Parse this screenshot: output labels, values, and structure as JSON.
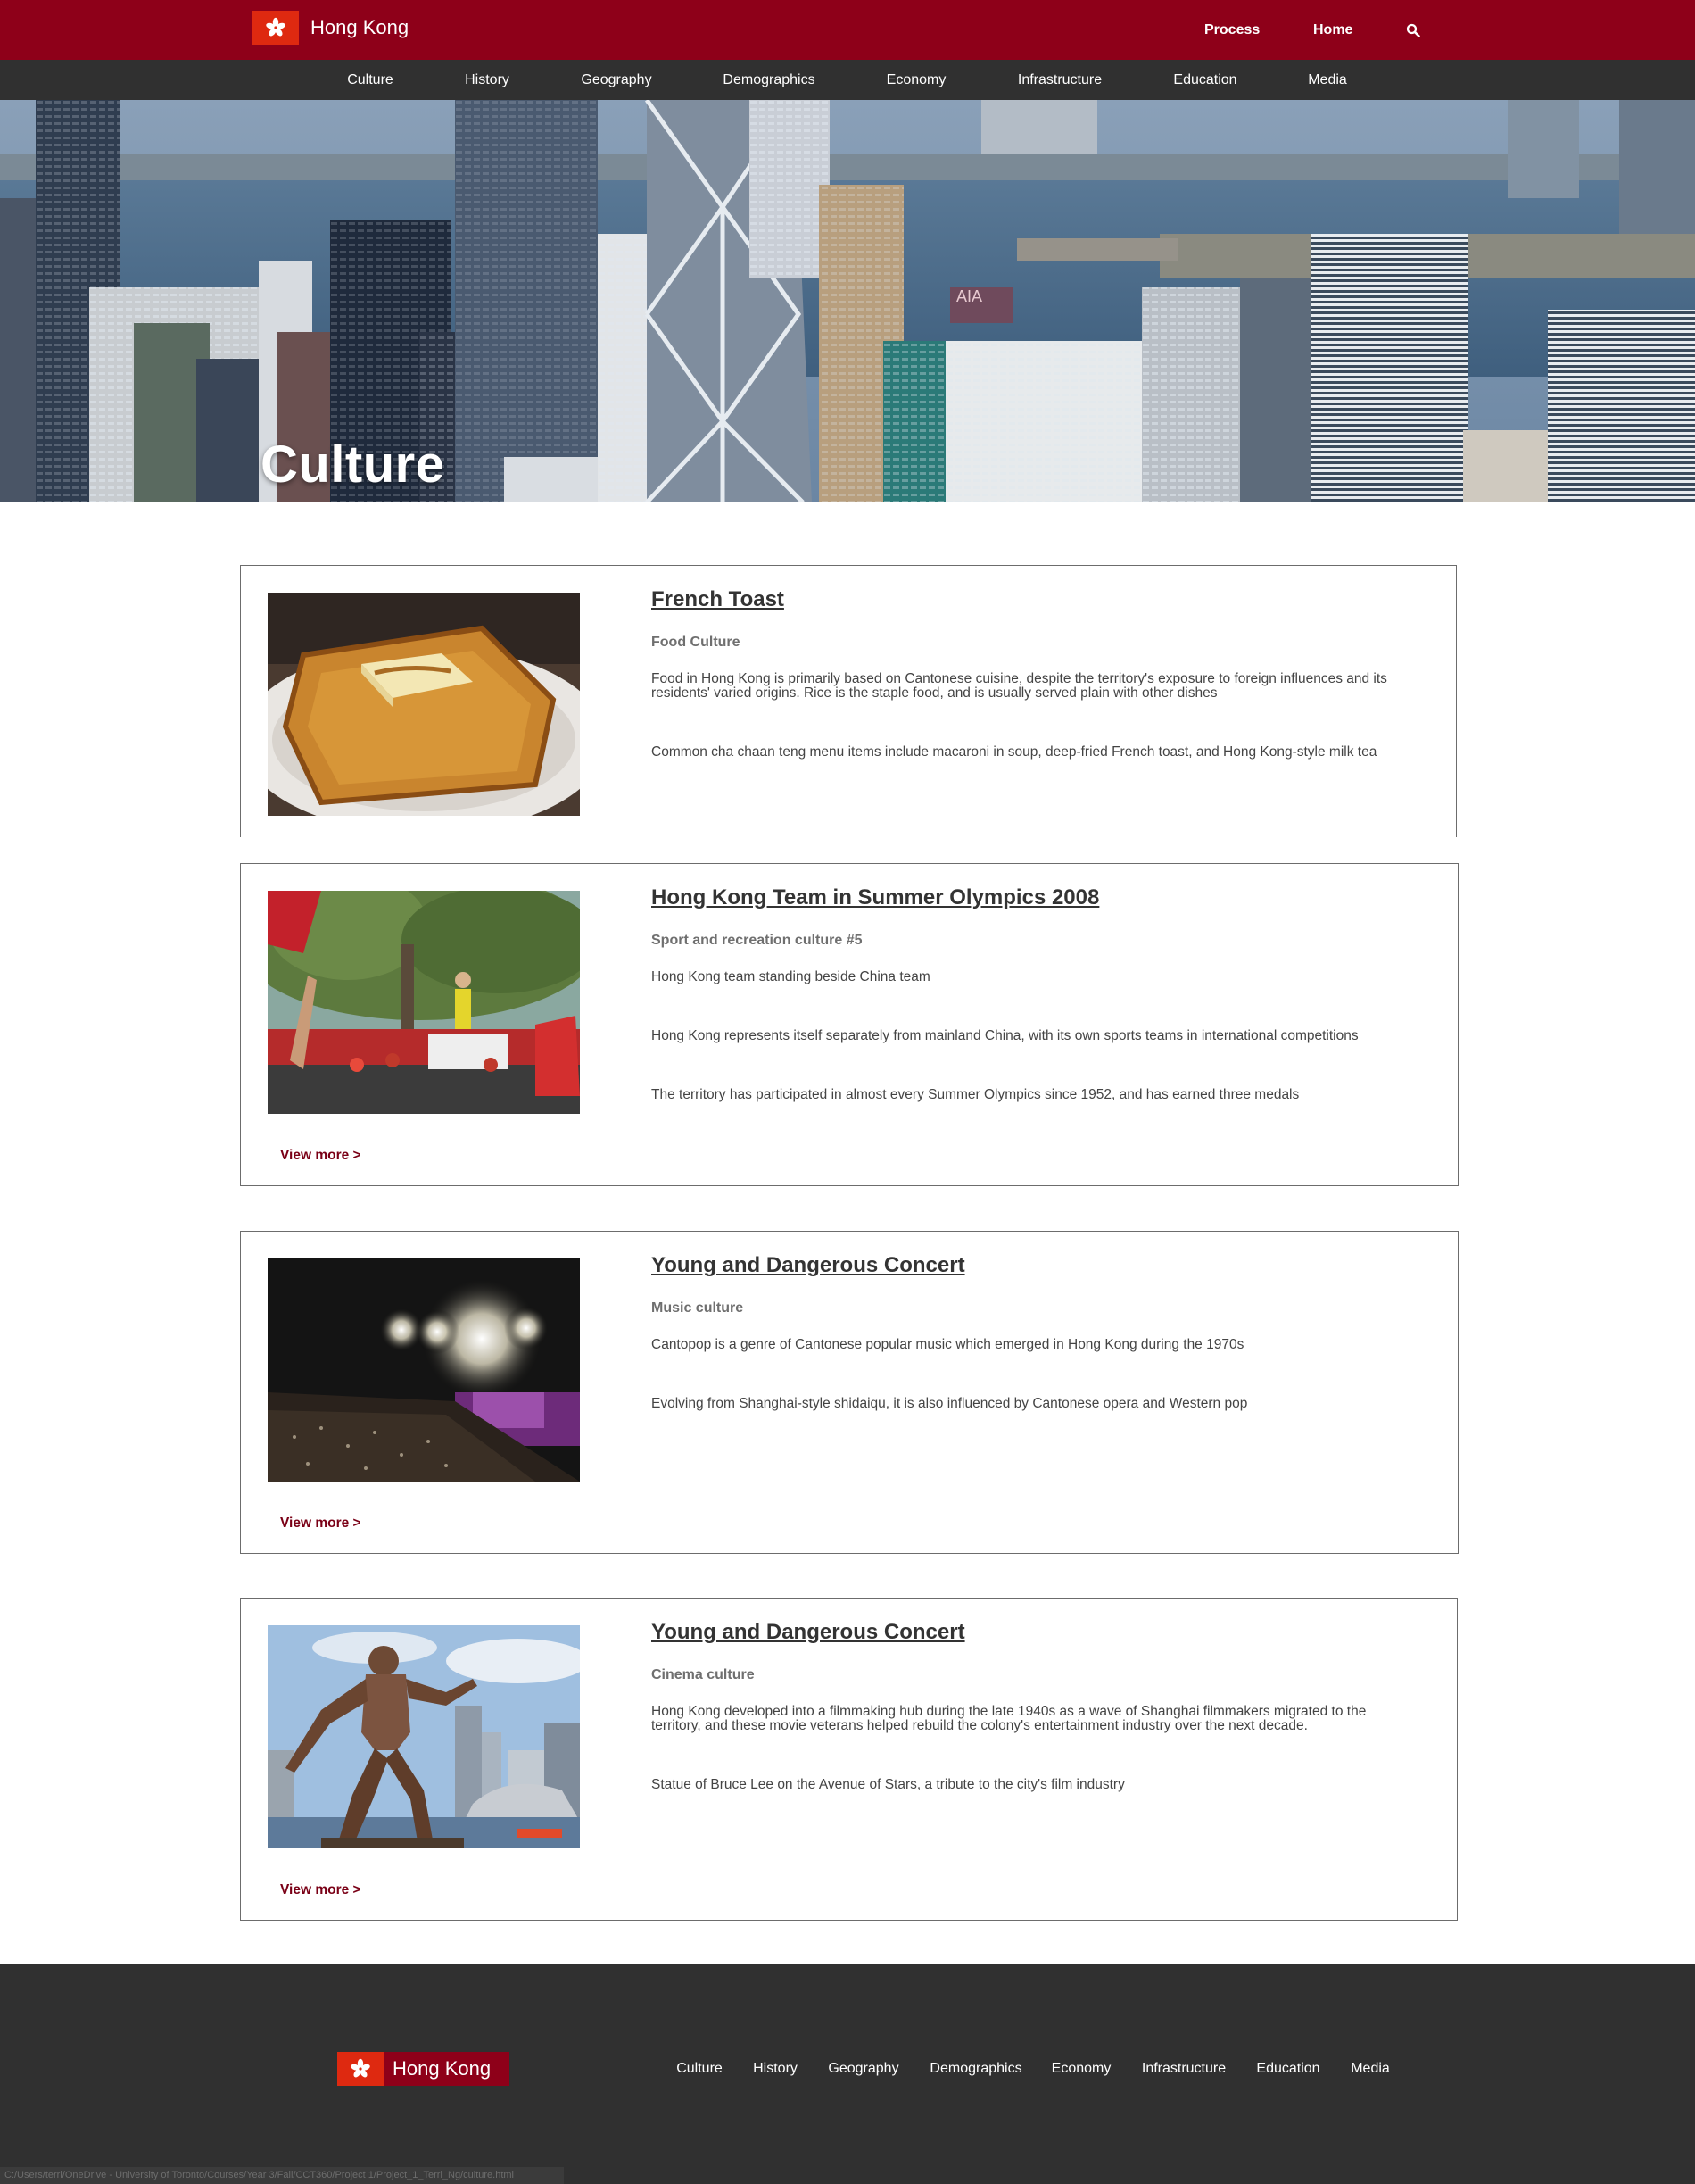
{
  "header": {
    "brand": "Hong Kong",
    "nav": [
      "Process",
      "Home"
    ],
    "search_icon": "search-icon"
  },
  "subnav": [
    "Culture",
    "History",
    "Geography",
    "Demographics",
    "Economy",
    "Infrastructure",
    "Education",
    "Media"
  ],
  "hero": {
    "title": "Culture"
  },
  "cards": [
    {
      "title": "French Toast",
      "category": "Food Culture",
      "paragraphs": [
        "Food in Hong Kong is primarily based on Cantonese cuisine, despite the territory's exposure to foreign influences and its residents' varied origins. Rice is the staple food, and is usually served plain with other dishes",
        "Common cha chaan teng menu items include macaroni in soup, deep-fried French toast, and Hong Kong-style milk tea"
      ],
      "view_more": ""
    },
    {
      "title": "Hong Kong Team in Summer Olympics 2008",
      "category": "Sport and recreation culture #5",
      "paragraphs": [
        "Hong Kong team standing beside China team",
        "Hong Kong represents itself separately from mainland China, with its own sports teams in international competitions",
        "The territory has participated in almost every Summer Olympics since 1952, and has earned three medals"
      ],
      "view_more": "View more >"
    },
    {
      "title": "Young and Dangerous Concert",
      "category": "Music culture",
      "paragraphs": [
        "Cantopop is a genre of Cantonese popular music which emerged in Hong Kong during the 1970s",
        "Evolving from Shanghai-style shidaiqu, it is also influenced by Cantonese opera and Western pop"
      ],
      "view_more": "View more >"
    },
    {
      "title": "Young and Dangerous Concert",
      "category": "Cinema culture",
      "paragraphs": [
        "Hong Kong developed into a filmmaking hub during the late 1940s as a wave of Shanghai filmmakers migrated to the territory, and these movie veterans helped rebuild the colony's entertainment industry over the next decade.",
        "Statue of Bruce Lee on the Avenue of Stars, a tribute to the city's film industry"
      ],
      "view_more": "View more >"
    }
  ],
  "footer": {
    "brand": "Hong Kong",
    "nav": [
      "Culture",
      "History",
      "Geography",
      "Demographics",
      "Economy",
      "Infrastructure",
      "Education",
      "Media"
    ]
  },
  "status_bar": {
    "path": "C:/Users/terri/OneDrive - University of Toronto/Courses/Year 3/Fall/CCT360/Project 1/Project_1_Terri_Ng/culture.html"
  },
  "colors": {
    "brand_red": "#8e0019",
    "flag_red": "#de2910",
    "dark_bar": "#303030",
    "link_red": "#7a0016"
  }
}
